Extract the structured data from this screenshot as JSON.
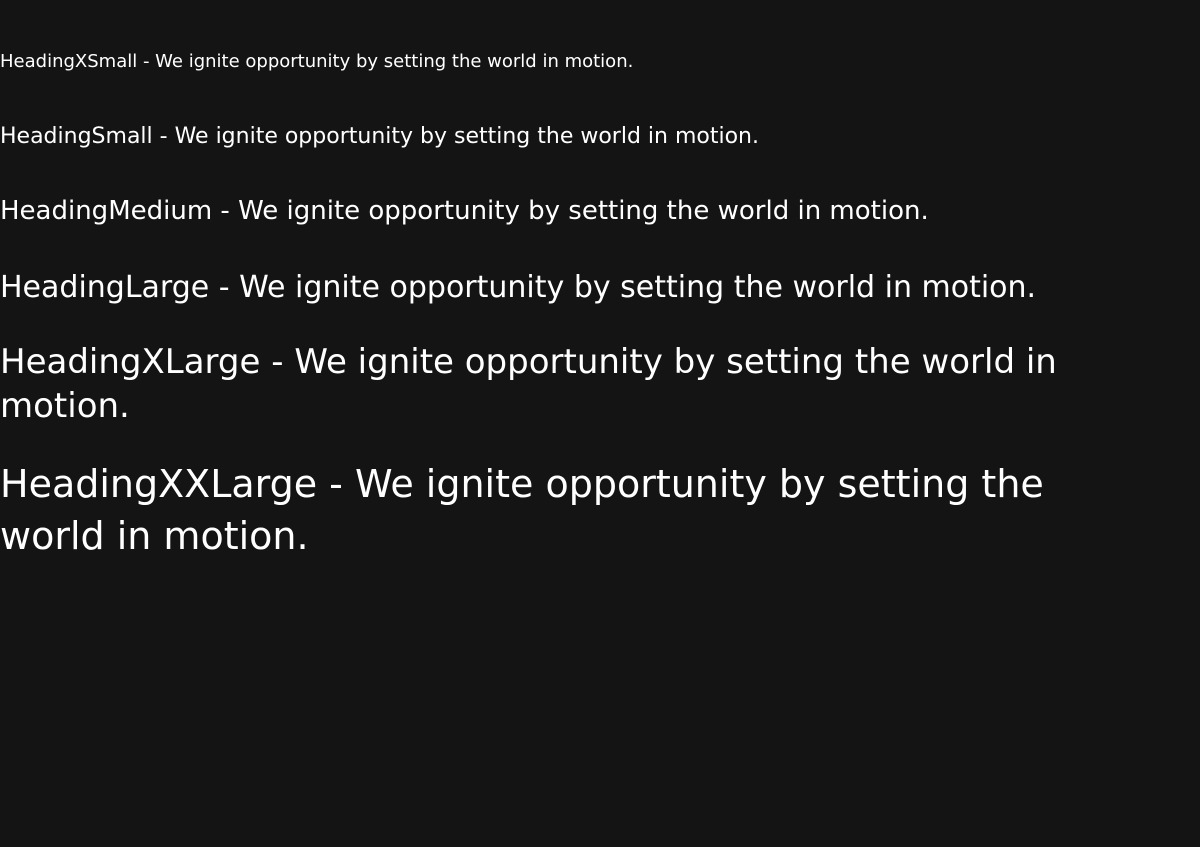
{
  "headings": {
    "xsmall": "HeadingXSmall - We ignite opportunity by setting the world in motion.",
    "small": "HeadingSmall - We ignite opportunity by setting the world in motion.",
    "medium": "HeadingMedium - We ignite opportunity by setting the world in motion.",
    "large": "HeadingLarge - We ignite opportunity by setting the world in motion.",
    "xlarge": "HeadingXLarge - We ignite opportunity by setting the world in motion.",
    "xxlarge": "HeadingXXLarge - We ignite opportunity by setting the world in motion."
  },
  "colors": {
    "background": "#141414",
    "text": "#ffffff"
  }
}
